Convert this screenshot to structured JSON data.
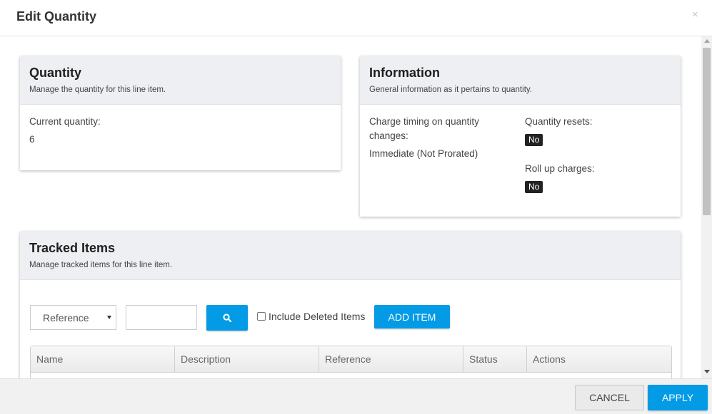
{
  "modal": {
    "title": "Edit Quantity",
    "close_glyph": "×"
  },
  "quantity_panel": {
    "title": "Quantity",
    "subtitle": "Manage the quantity for this line item.",
    "current_label": "Current quantity:",
    "current_value": "6"
  },
  "information_panel": {
    "title": "Information",
    "subtitle": "General information as it pertains to quantity.",
    "charge_timing_label": "Charge timing on quantity changes:",
    "charge_timing_value": "Immediate (Not Prorated)",
    "quantity_resets_label": "Quantity resets:",
    "quantity_resets_value": "No",
    "roll_up_label": "Roll up charges:",
    "roll_up_value": "No"
  },
  "tracked_items": {
    "title": "Tracked Items",
    "subtitle": "Manage tracked items for this line item.",
    "filter_select": {
      "selected": "Reference"
    },
    "search_input": {
      "value": ""
    },
    "search_icon": "search-icon",
    "include_deleted_label": "Include Deleted Items",
    "include_deleted_checked": false,
    "add_item_label": "ADD ITEM",
    "columns": [
      "Name",
      "Description",
      "Reference",
      "Status",
      "Actions"
    ]
  },
  "footer": {
    "cancel_label": "CANCEL",
    "apply_label": "APPLY"
  },
  "colors": {
    "primary": "#039be5",
    "panel_header": "#edeff2",
    "badge": "#222222"
  }
}
